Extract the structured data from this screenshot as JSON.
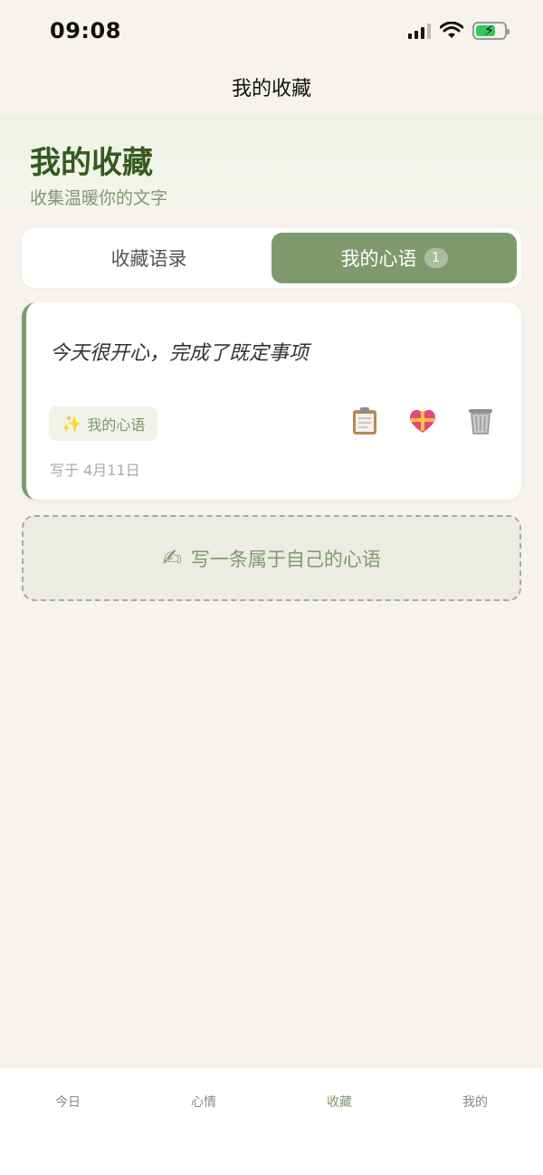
{
  "status_bar": {
    "time": "09:08"
  },
  "nav": {
    "title": "我的收藏"
  },
  "header": {
    "title": "我的收藏",
    "subtitle": "收集温暖你的文字"
  },
  "tabs": [
    {
      "label": "收藏语录",
      "active": false
    },
    {
      "label": "我的心语",
      "active": true,
      "badge": "1"
    }
  ],
  "card": {
    "quote": "今天很开心，完成了既定事项",
    "tag_icon": "sparkles-icon",
    "tag": "我的心语",
    "date": "写于 4月11日",
    "actions": [
      "clipboard-icon",
      "heart-ribbon-icon",
      "trash-icon"
    ]
  },
  "write_button": {
    "label": "写一条属于自己的心语",
    "icon": "writing-hand-icon"
  },
  "bottom_nav": [
    {
      "label": "今日",
      "active": false
    },
    {
      "label": "心情",
      "active": false
    },
    {
      "label": "收藏",
      "active": true
    },
    {
      "label": "我的",
      "active": false
    }
  ],
  "colors": {
    "accent": "#7e9a6d",
    "heading": "#355a1e",
    "background": "#f6f3ee"
  }
}
